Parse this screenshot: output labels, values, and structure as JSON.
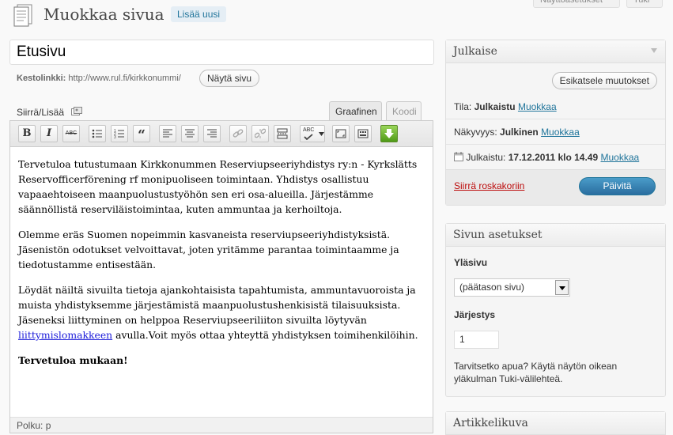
{
  "header": {
    "screen_options": "Näyttöasetukset",
    "help": "Tuki",
    "title": "Muokkaa sivua",
    "add_new": "Lisää uusi"
  },
  "post": {
    "title": "Etusivu",
    "permalink_label": "Kestolinkki:",
    "permalink_url": "http://www.rul.fi/kirkkonummi/",
    "view_button": "Näytä sivu"
  },
  "editor": {
    "upload_label": "Siirrä/Lisää",
    "tab_visual": "Graafinen",
    "tab_html": "Koodi",
    "toolbar": [
      {
        "name": "bold-button",
        "icon": "bold-icon",
        "glyph": "B"
      },
      {
        "name": "italic-button",
        "icon": "italic-icon",
        "glyph": "I"
      },
      {
        "name": "strikethrough-button",
        "icon": "strikethrough-icon",
        "glyph": "ABC"
      },
      {
        "name": "bullet-list-button",
        "icon": "bullet-list-icon",
        "glyph": ""
      },
      {
        "name": "numbered-list-button",
        "icon": "numbered-list-icon",
        "glyph": ""
      },
      {
        "name": "blockquote-button",
        "icon": "blockquote-icon",
        "glyph": "“"
      },
      {
        "name": "align-left-button",
        "icon": "align-left-icon",
        "glyph": ""
      },
      {
        "name": "align-center-button",
        "icon": "align-center-icon",
        "glyph": ""
      },
      {
        "name": "align-right-button",
        "icon": "align-right-icon",
        "glyph": ""
      },
      {
        "name": "insert-link-button",
        "icon": "link-icon",
        "glyph": ""
      },
      {
        "name": "unlink-button",
        "icon": "unlink-icon",
        "glyph": ""
      },
      {
        "name": "more-tag-button",
        "icon": "more-tag-icon",
        "glyph": ""
      },
      {
        "name": "spellcheck-button",
        "icon": "spellcheck-icon",
        "glyph": "ABC"
      },
      {
        "name": "fullscreen-button",
        "icon": "fullscreen-icon",
        "glyph": ""
      },
      {
        "name": "kitchen-sink-button",
        "icon": "kitchen-sink-icon",
        "glyph": ""
      },
      {
        "name": "custom-plugin-button",
        "icon": "green-arrow-icon",
        "glyph": ""
      }
    ],
    "paragraphs": [
      "Tervetuloa tutustumaan Kirkkonummen Reserviupseeriyhdistys ry:n - Kyrkslätts Reservofficerförening rf monipuoliseen toimintaan. Yhdistys osallistuu vapaaehtoiseen maanpuolustustyöhön sen eri osa-alueilla. Järjestämme säännöllistä reserviläistoimintaa, kuten ammuntaa ja kerhoiltoja.",
      "Olemme eräs Suomen nopeimmin kasvaneista reserviupseeriyhdistyksistä. Jäsenistön odotukset velvoittavat, joten yritämme parantaa toimintaamme ja tiedotustamme entisestään.",
      "Löydät näiltä sivuilta tietoja ajankohtaisista tapahtumista, ammuntavuoroista ja muista yhdistyksemme järjestämistä maanpuolustushenkisistä tilaisuuksista. Jäseneksi liittyminen on helppoa Reserviupseeriliiton sivuilta löytyvän"
    ],
    "link_text": "liittymislomakkeen",
    "after_link": " avulla.Voit myös ottaa yhteyttä yhdistyksen toimihenkilöihin.",
    "closing": "Tervetuloa mukaan!",
    "path_label": "Polku:",
    "path_value": "p"
  },
  "publish": {
    "title": "Julkaise",
    "preview_button": "Esikatsele muutokset",
    "status_label": "Tila:",
    "status_value": "Julkaistu",
    "edit_link": "Muokkaa",
    "visibility_label": "Näkyvyys:",
    "visibility_value": "Julkinen",
    "published_label": "Julkaistu:",
    "published_value": "17.12.2011 klo 14.49",
    "trash_link": "Siirrä roskakoriin",
    "update_button": "Päivitä"
  },
  "page_attributes": {
    "title": "Sivun asetukset",
    "parent_label": "Yläsivu",
    "parent_value": "(päätason sivu)",
    "order_label": "Järjestys",
    "order_value": "1",
    "help_text": "Tarvitsetko apua? Käytä näytön oikean yläkulman Tuki-välilehteä."
  },
  "featured_image": {
    "title": "Artikkelikuva"
  }
}
